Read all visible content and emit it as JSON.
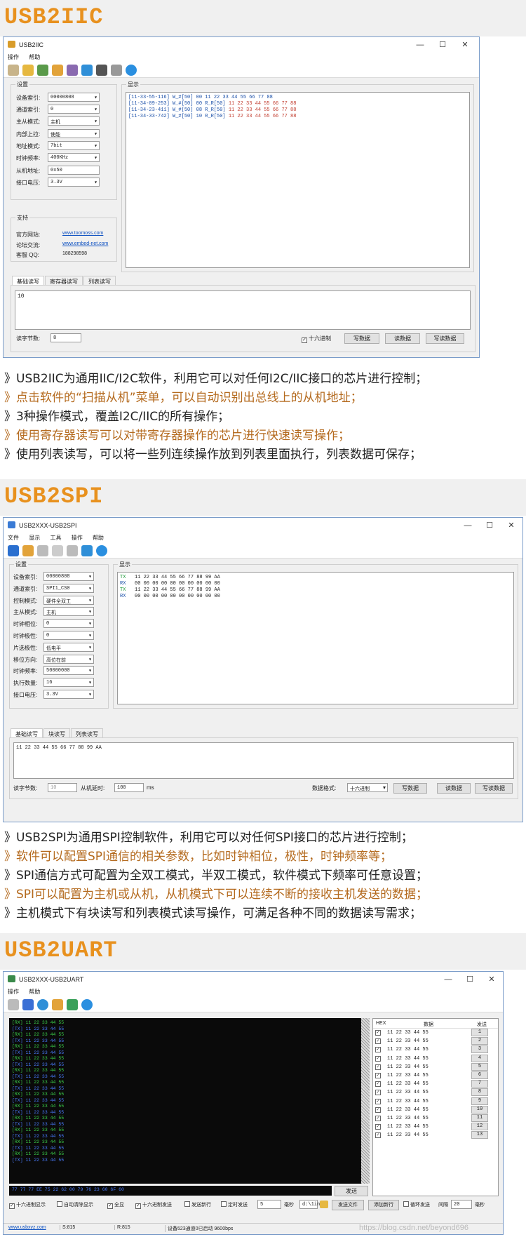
{
  "i2c": {
    "heading": "USB2IIC",
    "window_title": "USB2IIC",
    "menu": [
      "操作",
      "帮助"
    ],
    "settings_label": "设置",
    "display_label": "显示",
    "fields": [
      {
        "label": "设备索引:",
        "value": "00000808"
      },
      {
        "label": "通道索引:",
        "value": "0"
      },
      {
        "label": "主从模式:",
        "value": "主机"
      },
      {
        "label": "内部上拉:",
        "value": "使能"
      },
      {
        "label": "地址模式:",
        "value": "7bit"
      },
      {
        "label": "时钟频率:",
        "value": "400KHz"
      },
      {
        "label": "从机地址:",
        "value": "0x50"
      },
      {
        "label": "接口电压:",
        "value": "3.3V"
      }
    ],
    "support_label": "支持",
    "support": [
      {
        "label": "官方网站:",
        "value": "www.toomoss.com"
      },
      {
        "label": "论坛交流:",
        "value": "www.embed-net.com"
      },
      {
        "label": "客服 QQ:",
        "value": "188298598"
      }
    ],
    "log": [
      {
        "p": "[11-33-55-116] ",
        "k": "W_#[50] ",
        "d": "00 11 22 33 44 55 66 77 88"
      },
      {
        "p": "[11-34-09-253] ",
        "k": "W_#[50] 00 R_R[50] ",
        "d": "11 22 33 44 55 66 77 88"
      },
      {
        "p": "[11-34-23-411] ",
        "k": "W_#[50] 08 R_R[50] ",
        "d": "11 22 33 44 55 66 77 88"
      },
      {
        "p": "[11-34-33-742] ",
        "k": "W_#[50] 10 R_R[50] ",
        "d": "11 22 33 44 55 66 77 88"
      }
    ],
    "tabs": [
      "基础读写",
      "寄存器读写",
      "列表读写"
    ],
    "data_text": "10",
    "bytes_label": "读字节数:",
    "bytes_value": "8",
    "hex_label": "十六进制",
    "buttons": [
      "写数据",
      "读数据",
      "写读数据"
    ]
  },
  "i2c_desc": [
    "》USB2IIC为通用IIC/I2C软件，利用它可以对任何I2C/IIC接口的芯片进行控制；",
    "》点击软件的“扫描从机”菜单，可以自动识别出总线上的从机地址；",
    "》3种操作模式，覆盖I2C/IIC的所有操作；",
    "》使用寄存器读写可以对带寄存器操作的芯片进行快速读写操作；",
    "》使用列表读写，可以将一些列连续操作放到列表里面执行，列表数据可保存；"
  ],
  "spi": {
    "heading": "USB2SPI",
    "window_title": "USB2XXX-USB2SPI",
    "menu": [
      "文件",
      "显示",
      "工具",
      "操作",
      "帮助"
    ],
    "settings_label": "设置",
    "display_label": "显示",
    "fields": [
      {
        "label": "设备索引:",
        "value": "00000808"
      },
      {
        "label": "通道索引:",
        "value": "SPI1_CS0"
      },
      {
        "label": "控制模式:",
        "value": "硬件全双工"
      },
      {
        "label": "主从模式:",
        "value": "主机"
      },
      {
        "label": "时钟相位:",
        "value": "0"
      },
      {
        "label": "时钟极性:",
        "value": "0"
      },
      {
        "label": "片选极性:",
        "value": "低电平"
      },
      {
        "label": "移位方向:",
        "value": "高位在前"
      },
      {
        "label": "时钟频率:",
        "value": "50000000"
      },
      {
        "label": "执行数量:",
        "value": "16"
      },
      {
        "label": "接口电压:",
        "value": "3.3V"
      }
    ],
    "log": [
      {
        "k": "TX",
        "d": "   11 22 33 44 55 66 77 88 99 AA"
      },
      {
        "k": "RX",
        "d": "   00 00 00 00 00 00 00 00 00 00"
      },
      {
        "k": "TX",
        "d": "   11 22 33 44 55 66 77 88 99 AA"
      },
      {
        "k": "RX",
        "d": "   00 00 00 00 00 00 00 00 00 00"
      }
    ],
    "tabs": [
      "基础读写",
      "块读写",
      "列表读写"
    ],
    "data_text": "11 22 33 44 55 66 77 88 99 AA",
    "bytes_label": "读字节数:",
    "bytes_value": "10",
    "slave_delay_label": "从机延时:",
    "slave_delay_value": "100",
    "unit": "ms",
    "format_label": "数据格式:",
    "format_value": "十六进制",
    "buttons": [
      "写数据",
      "读数据",
      "写读数据"
    ]
  },
  "spi_desc": [
    "》USB2SPI为通用SPI控制软件，利用它可以对任何SPI接口的芯片进行控制；",
    "》软件可以配置SPI通信的相关参数，比如时钟相位，极性，时钟频率等；",
    "》SPI通信方式可配置为全双工模式，半双工模式，软件模式下频率可任意设置；",
    "》SPI可以配置为主机或从机，从机模式下可以连续不断的接收主机发送的数据；",
    "》主机模式下有块读写和列表模式读写操作，可满足各种不同的数据读写需求；"
  ],
  "uart": {
    "heading": "USB2UART",
    "window_title": "USB2XXX-USB2UART",
    "menu": [
      "操作",
      "帮助"
    ],
    "log_rows": [
      {
        "k": "[RX]",
        "d": " 11 22 33 44 55"
      },
      {
        "k": "[TX]",
        "d": " 11 22 33 44 55"
      },
      {
        "k": "[RX]",
        "d": " 11 22 33 44 55"
      },
      {
        "k": "[TX]",
        "d": " 11 22 33 44 55"
      },
      {
        "k": "[RX]",
        "d": " 11 22 33 44 55"
      },
      {
        "k": "[TX]",
        "d": " 11 22 33 44 55"
      },
      {
        "k": "[RX]",
        "d": " 11 22 33 44 55"
      },
      {
        "k": "[TX]",
        "d": " 11 22 33 44 55"
      },
      {
        "k": "[RX]",
        "d": " 11 22 33 44 55"
      },
      {
        "k": "[TX]",
        "d": " 11 22 33 44 55"
      },
      {
        "k": "[RX]",
        "d": " 11 22 33 44 55"
      },
      {
        "k": "[TX]",
        "d": " 11 22 33 44 55"
      },
      {
        "k": "[RX]",
        "d": " 11 22 33 44 55"
      },
      {
        "k": "[TX]",
        "d": " 11 22 33 44 55"
      },
      {
        "k": "[RX]",
        "d": " 11 22 33 44 55"
      },
      {
        "k": "[TX]",
        "d": " 11 22 33 44 55"
      },
      {
        "k": "[RX]",
        "d": " 11 22 33 44 55"
      },
      {
        "k": "[TX]",
        "d": " 11 22 33 44 55"
      },
      {
        "k": "[RX]",
        "d": " 11 22 33 44 55"
      },
      {
        "k": "[TX]",
        "d": " 11 22 33 44 55"
      },
      {
        "k": "[RX]",
        "d": " 11 22 33 44 55"
      },
      {
        "k": "[TX]",
        "d": " 11 22 33 44 55"
      },
      {
        "k": "[RX]",
        "d": " 11 22 33 44 55"
      },
      {
        "k": "[TX]",
        "d": " 11 22 33 44 55"
      }
    ],
    "send_text": "77 77 77 EE 75 22 62 00 79 76 23 60 6F 60",
    "send_label": "发送",
    "list_headers": [
      "HEX",
      "数据",
      "发送"
    ],
    "list_data": "11 22 33 44 55",
    "list_ids": [
      "1",
      "2",
      "3",
      "4",
      "5",
      "6",
      "7",
      "8",
      "9",
      "10",
      "11",
      "12",
      "13"
    ],
    "opts": [
      "十六进制显示",
      "自动清除显示",
      "全显",
      "十六进制发送",
      "发送新行",
      "定时发送"
    ],
    "timer_value": "5",
    "timer_unit": "毫秒",
    "file_value": "d:\\1in",
    "send_file": "发送文件",
    "add_row": "添加新行",
    "loop_send": "循环发送",
    "interval_label": "间隔",
    "interval_value": "20",
    "interval_unit": "毫秒",
    "status": [
      "www.usbxyz.com",
      "S:815",
      "R:815",
      "设备523通道0已启动 9600bps"
    ]
  },
  "watermark": "https://blog.csdn.net/beyond696"
}
